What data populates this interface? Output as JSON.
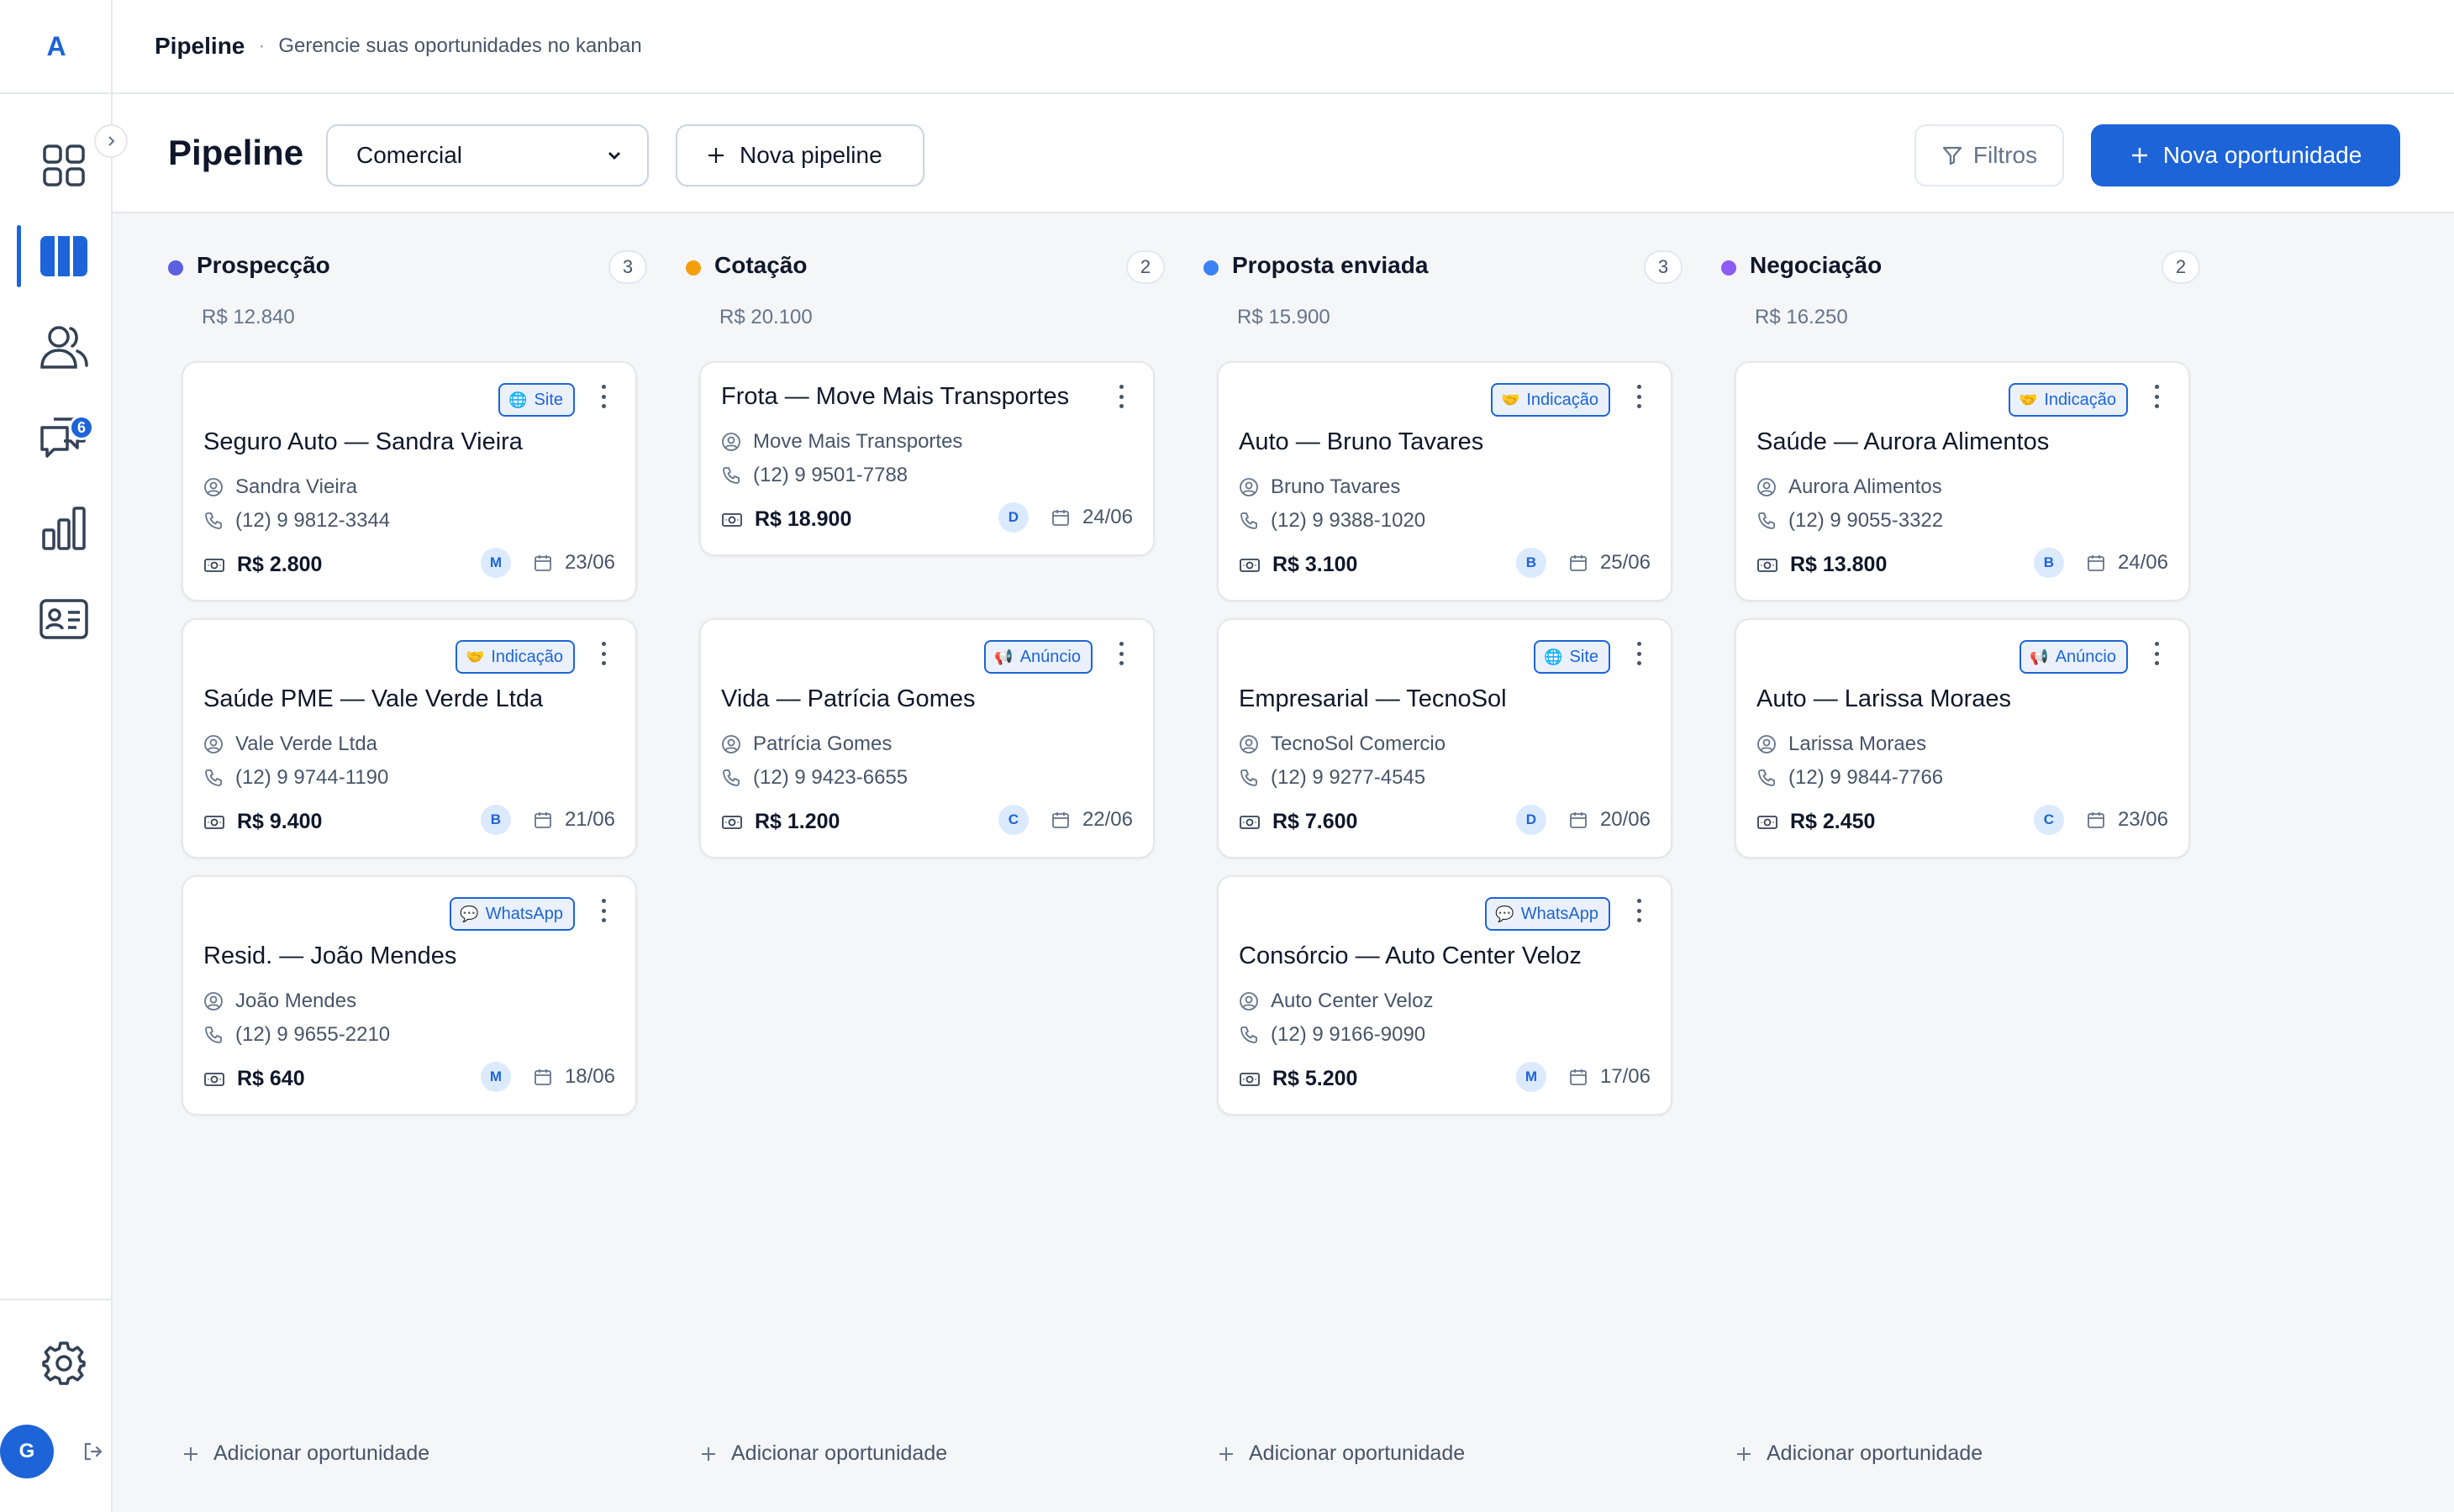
{
  "sidebar": {
    "logo": "A",
    "chat_badge": "6",
    "user_initial": "G"
  },
  "topbar": {
    "title": "Pipeline",
    "separator": "·",
    "subtitle": "Gerencie suas oportunidades no kanban"
  },
  "header": {
    "title": "Pipeline",
    "pipeline_select": "Comercial",
    "new_pipeline_label": "Nova pipeline",
    "filters_label": "Filtros",
    "new_opportunity_label": "Nova oportunidade"
  },
  "colors": {
    "accent": "#1d64d8",
    "prospeccao": "#5b5fe0",
    "cotacao": "#f59e0b",
    "proposta": "#3b82f6",
    "negociacao": "#8b5cf6"
  },
  "add_label": "Adicionar oportunidade",
  "columns": [
    {
      "title": "Prospecção",
      "count": "3",
      "total": "R$ 12.840",
      "cards": [
        {
          "tag": "Site",
          "tag_icon": "globe-icon",
          "title": "Seguro Auto — Sandra Vieira",
          "contact": "Sandra Vieira",
          "phone": "(12) 9 9812-3344",
          "value": "R$ 2.800",
          "owner": "M",
          "date": "23/06"
        },
        {
          "tag": "Indicação",
          "tag_icon": "handshake-icon",
          "title": "Saúde PME — Vale Verde Ltda",
          "contact": "Vale Verde Ltda",
          "phone": "(12) 9 9744-1190",
          "value": "R$ 9.400",
          "owner": "B",
          "date": "21/06"
        },
        {
          "tag": "WhatsApp",
          "tag_icon": "speech-bubble-icon",
          "title": "Resid. — João Mendes",
          "contact": "João Mendes",
          "phone": "(12) 9 9655-2210",
          "value": "R$ 640",
          "owner": "M",
          "date": "18/06"
        }
      ]
    },
    {
      "title": "Cotação",
      "count": "2",
      "total": "R$ 20.100",
      "cards": [
        {
          "tag": "",
          "tag_icon": "",
          "title": "Frota — Move Mais Transportes",
          "contact": "Move Mais Transportes",
          "phone": "(12) 9 9501-7788",
          "value": "R$ 18.900",
          "owner": "D",
          "date": "24/06"
        },
        {
          "tag": "Anúncio",
          "tag_icon": "megaphone-icon",
          "title": "Vida — Patrícia Gomes",
          "contact": "Patrícia Gomes",
          "phone": "(12) 9 9423-6655",
          "value": "R$ 1.200",
          "owner": "C",
          "date": "22/06"
        }
      ]
    },
    {
      "title": "Proposta enviada",
      "count": "3",
      "total": "R$ 15.900",
      "cards": [
        {
          "tag": "Indicação",
          "tag_icon": "handshake-icon",
          "title": "Auto — Bruno Tavares",
          "contact": "Bruno Tavares",
          "phone": "(12) 9 9388-1020",
          "value": "R$ 3.100",
          "owner": "B",
          "date": "25/06"
        },
        {
          "tag": "Site",
          "tag_icon": "globe-icon",
          "title": "Empresarial — TecnoSol",
          "contact": "TecnoSol Comercio",
          "phone": "(12) 9 9277-4545",
          "value": "R$ 7.600",
          "owner": "D",
          "date": "20/06"
        },
        {
          "tag": "WhatsApp",
          "tag_icon": "speech-bubble-icon",
          "title": "Consórcio — Auto Center Veloz",
          "contact": "Auto Center Veloz",
          "phone": "(12) 9 9166-9090",
          "value": "R$ 5.200",
          "owner": "M",
          "date": "17/06"
        }
      ]
    },
    {
      "title": "Negociação",
      "count": "2",
      "total": "R$ 16.250",
      "cards": [
        {
          "tag": "Indicação",
          "tag_icon": "handshake-icon",
          "title": "Saúde — Aurora Alimentos",
          "contact": "Aurora Alimentos",
          "phone": "(12) 9 9055-3322",
          "value": "R$ 13.800",
          "owner": "B",
          "date": "24/06"
        },
        {
          "tag": "Anúncio",
          "tag_icon": "megaphone-icon",
          "title": "Auto — Larissa Moraes",
          "contact": "Larissa Moraes",
          "phone": "(12) 9 9844-7766",
          "value": "R$ 2.450",
          "owner": "C",
          "date": "23/06"
        }
      ]
    }
  ]
}
